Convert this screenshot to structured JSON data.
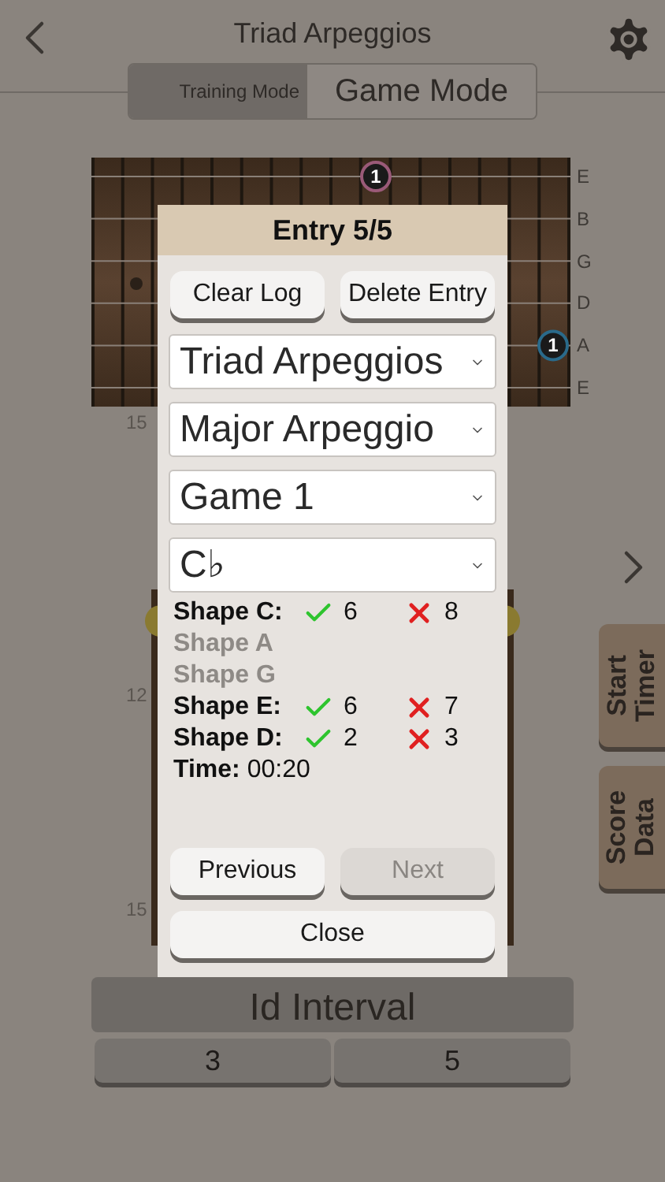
{
  "header": {
    "title": "Triad Arpeggios"
  },
  "mode_tabs": [
    {
      "label": "Training Mode",
      "selected": true
    },
    {
      "label": "Game Mode",
      "selected": false
    }
  ],
  "fretboard": {
    "strings": [
      "E",
      "B",
      "G",
      "D",
      "A",
      "E"
    ],
    "markers": [
      {
        "text": "1",
        "color": "#9a5a78"
      },
      {
        "text": "1",
        "color": "#2a6a8a"
      }
    ],
    "fret_label": "15"
  },
  "neck": {
    "fret_labels": [
      "12",
      "15"
    ]
  },
  "side_buttons": [
    "Start Timer",
    "Score Data"
  ],
  "prompt": "Id Interval",
  "answers": [
    "3",
    "5"
  ],
  "dialog": {
    "title": "Entry 5/5",
    "top_buttons": [
      "Clear Log",
      "Delete Entry"
    ],
    "selects": [
      "Triad Arpeggios",
      "Major Arpeggio",
      "Game 1",
      "C♭"
    ],
    "scores": [
      {
        "label": "Shape C:",
        "disabled": false,
        "correct": "6",
        "wrong": "8"
      },
      {
        "label": "Shape A",
        "disabled": true
      },
      {
        "label": "Shape G",
        "disabled": true
      },
      {
        "label": "Shape E:",
        "disabled": false,
        "correct": "6",
        "wrong": "7"
      },
      {
        "label": "Shape D:",
        "disabled": false,
        "correct": "2",
        "wrong": "3"
      }
    ],
    "time": "**Time:** 00:20",
    "nav_buttons": [
      {
        "label": "Previous",
        "disabled": false
      },
      {
        "label": "Next",
        "disabled": true
      }
    ],
    "close": "Close"
  }
}
